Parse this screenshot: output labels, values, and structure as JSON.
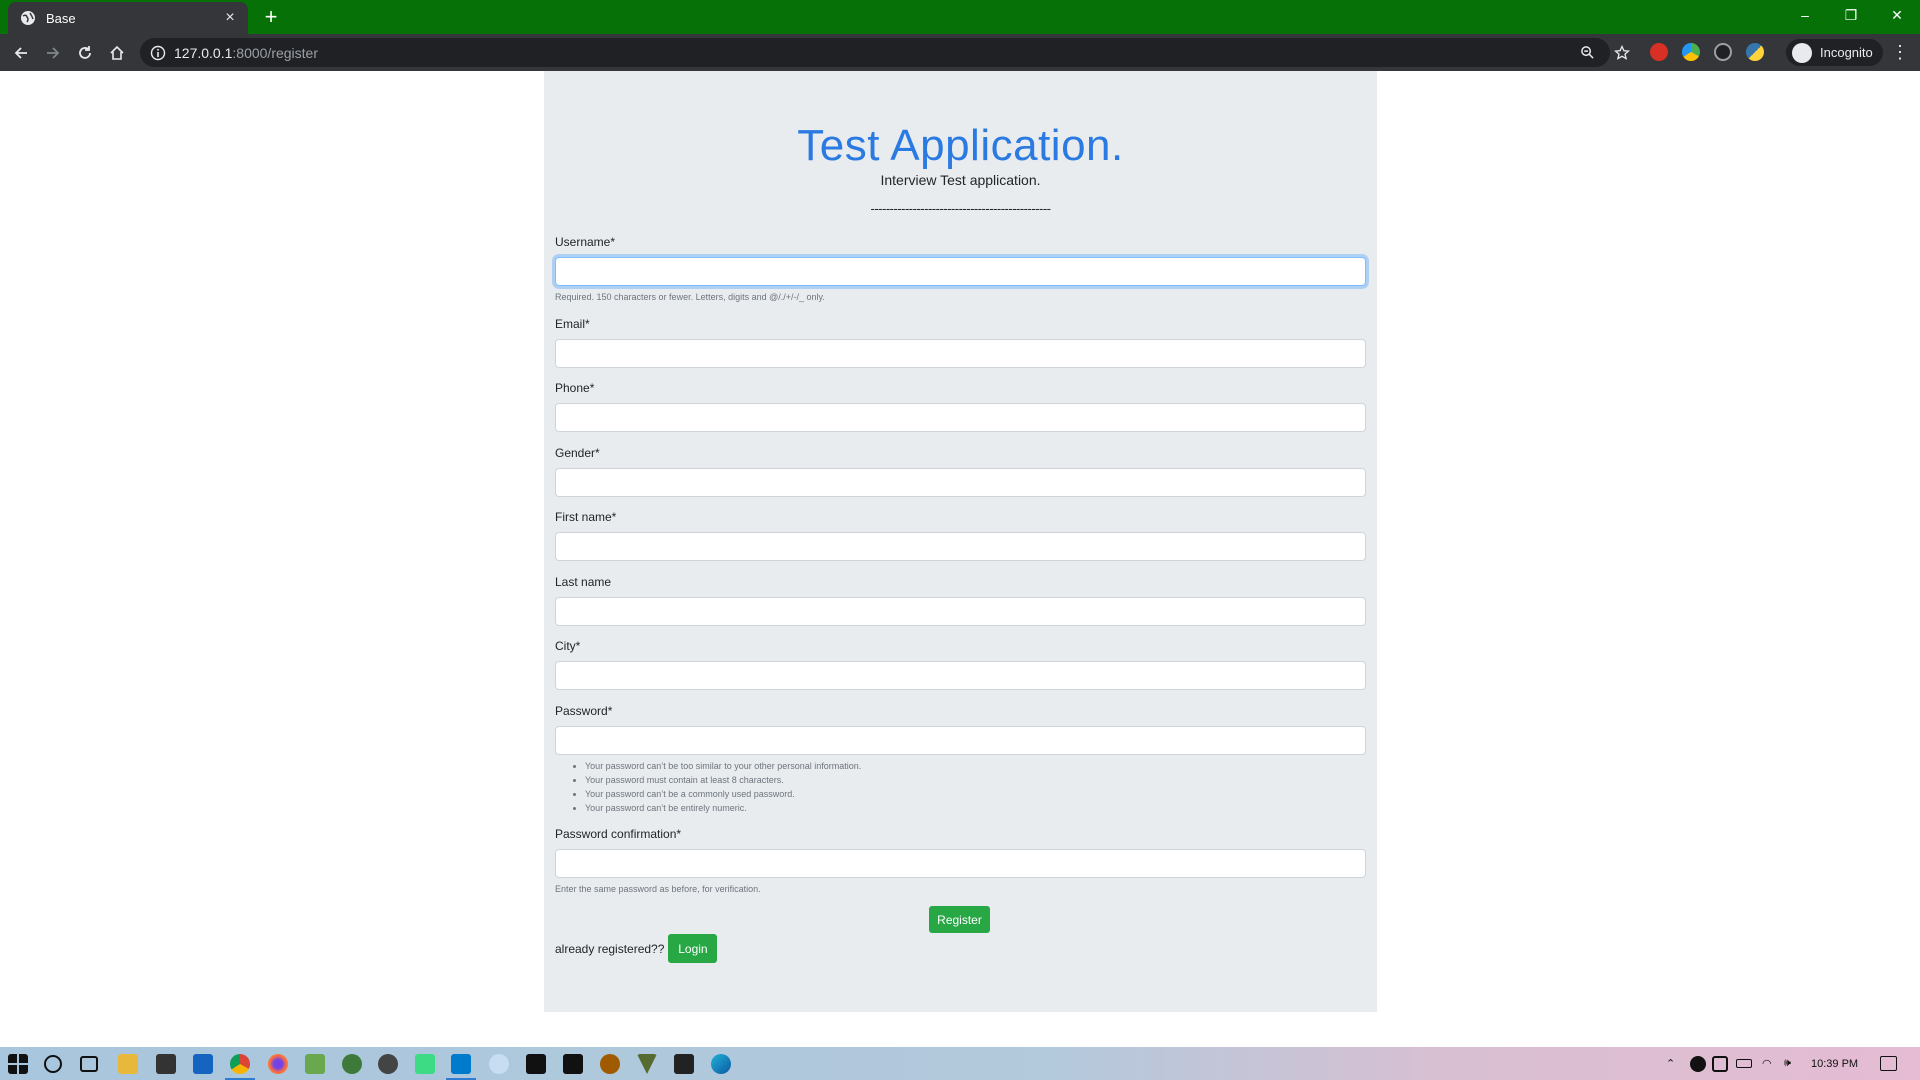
{
  "browser": {
    "tab_title": "Base",
    "tab_close": "×",
    "new_tab": "+",
    "url_host": "127.0.0.1",
    "url_rest": ":8000/register",
    "profile_label": "Incognito",
    "menu": "⋮",
    "window_controls": {
      "minimize": "–",
      "maximize": "❐",
      "close": "✕"
    }
  },
  "page": {
    "title": "Test Application.",
    "subtitle": "Interview Test application.",
    "divider": "-----------------------------------------------"
  },
  "form": {
    "username": {
      "label": "Username*",
      "value": "",
      "help": "Required. 150 characters or fewer. Letters, digits and @/./+/-/_ only."
    },
    "email": {
      "label": "Email*",
      "value": ""
    },
    "phone": {
      "label": "Phone*",
      "value": ""
    },
    "gender": {
      "label": "Gender*",
      "value": ""
    },
    "first_name": {
      "label": "First name*",
      "value": ""
    },
    "last_name": {
      "label": "Last name",
      "value": ""
    },
    "city": {
      "label": "City*",
      "value": ""
    },
    "password": {
      "label": "Password*",
      "value": "",
      "help_items": [
        "Your password can’t be too similar to your other personal information.",
        "Your password must contain at least 8 characters.",
        "Your password can’t be a commonly used password.",
        "Your password can’t be entirely numeric."
      ]
    },
    "password_confirmation": {
      "label": "Password confirmation*",
      "value": "",
      "help": "Enter the same password as before, for verification."
    },
    "register_label": "Register",
    "already_registered_text": "already registered??",
    "login_label": "Login"
  },
  "taskbar": {
    "clock": "10:39 PM"
  }
}
